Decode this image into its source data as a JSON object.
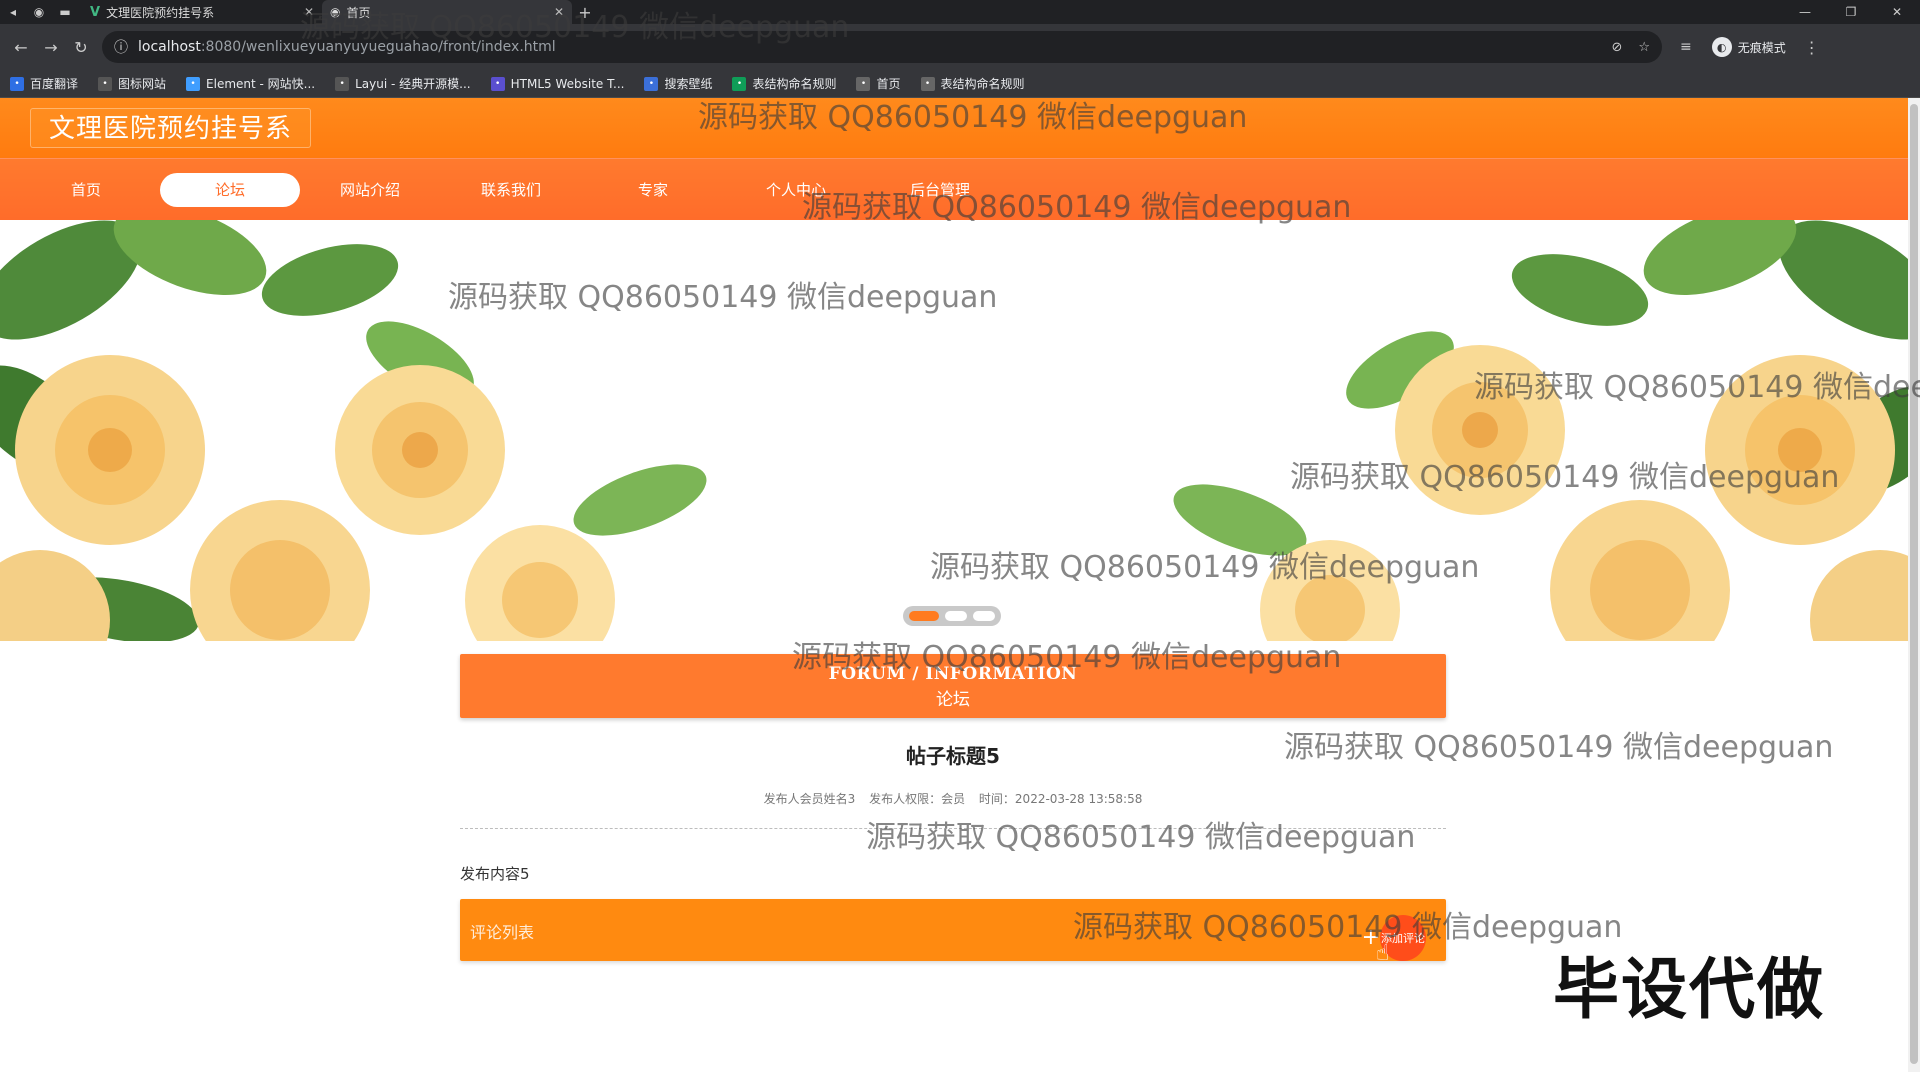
{
  "browser": {
    "tabs": [
      {
        "title": "文理医院预约挂号系"
      },
      {
        "title": "首页"
      }
    ],
    "url_host": "localhost",
    "url_path": ":8080/wenlixueyuanyuyueguahao/front/index.html",
    "profile_label": "无痕模式",
    "bookmarks": [
      {
        "label": "百度翻译",
        "icon": "translate-icon",
        "color": "#2f6fe4"
      },
      {
        "label": "图标网站",
        "icon": "flag-icon",
        "color": "#555555"
      },
      {
        "label": "Element - 网站快...",
        "icon": "element-icon",
        "color": "#409eff"
      },
      {
        "label": "Layui - 经典开源模...",
        "icon": "layui-icon",
        "color": "#555555"
      },
      {
        "label": "HTML5 Website T...",
        "icon": "html5-icon",
        "color": "#5a4fcf"
      },
      {
        "label": "搜索壁纸",
        "icon": "wallpaper-icon",
        "color": "#3b6fd8"
      },
      {
        "label": "表结构命名规则",
        "icon": "sheet-icon",
        "color": "#0f9d58"
      },
      {
        "label": "首页",
        "icon": "globe-icon",
        "color": "#666666"
      },
      {
        "label": "表结构命名规则",
        "icon": "globe-icon",
        "color": "#666666"
      }
    ]
  },
  "site": {
    "title": "文理医院预约挂号系",
    "nav": [
      {
        "label": "首页",
        "active": false
      },
      {
        "label": "论坛",
        "active": true
      },
      {
        "label": "网站介绍",
        "active": false
      },
      {
        "label": "联系我们",
        "active": false
      },
      {
        "label": "专家",
        "active": false
      },
      {
        "label": "个人中心",
        "active": false
      },
      {
        "label": "后台管理",
        "active": false
      }
    ],
    "colors": {
      "header": "#ff7b0f",
      "nav": "#ff6c2a",
      "forum_bar": "#ff7a2e",
      "comment_bar": "#ff8a10"
    }
  },
  "forum": {
    "title_en": "FORUM / INFORMATION",
    "title_cn": "论坛"
  },
  "post": {
    "title": "帖子标题5",
    "author": "发布人会员姓名3",
    "role": "发布人权限：会员",
    "time": "时间：2022-03-28 13:58:58",
    "content": "发布内容5"
  },
  "comments": {
    "label": "评论列表",
    "add_label": "添加评论"
  },
  "overlay": {
    "watermark": "源码获取 QQ86050149 微信deepguan",
    "big_text": "毕设代做"
  }
}
